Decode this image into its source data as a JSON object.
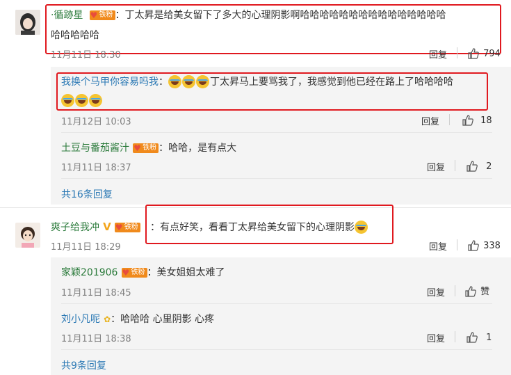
{
  "comments": [
    {
      "user": "·循跡星",
      "badge": "铁粉",
      "text": "：丁太昇是给美女留下了多大的心理阴影啊哈哈哈哈哈哈哈哈哈哈哈哈哈哈哈",
      "text2": "哈哈哈哈哈",
      "time": "11月11日 18:30",
      "reply": "回复",
      "likes": "794",
      "replies": [
        {
          "user": "我换个马甲你容易吗我",
          "text": "丁太昇马上要骂我了，我感觉到他已经在路上了哈哈哈哈",
          "time": "11月12日 10:03",
          "reply": "回复",
          "likes": "18"
        },
        {
          "user": "土豆与番茄酱汁",
          "badge": "铁粉",
          "text": "：哈哈，是有点大",
          "time": "11月11日 18:37",
          "reply": "回复",
          "likes": "2"
        }
      ],
      "more": "共16条回复"
    },
    {
      "user": "爽子给我冲",
      "badge": "铁粉",
      "text": "：有点好笑，看看丁太昇给美女留下的心理阴影",
      "time": "11月11日 18:29",
      "reply": "回复",
      "likes": "338",
      "replies": [
        {
          "user": "家颖201906",
          "badge": "铁粉",
          "text": "：美女姐姐太难了",
          "time": "11月11日 18:45",
          "reply": "回复",
          "likes": "赞"
        },
        {
          "user": "刘小凡呢",
          "text": "：哈哈哈 心里阴影 心疼",
          "time": "11月11日 18:38",
          "reply": "回复",
          "likes": "1"
        }
      ],
      "more": "共9条回复"
    }
  ],
  "colors": {
    "highlight": "#e0191f",
    "username": "#2a7a3a",
    "link": "#2a78b4"
  }
}
